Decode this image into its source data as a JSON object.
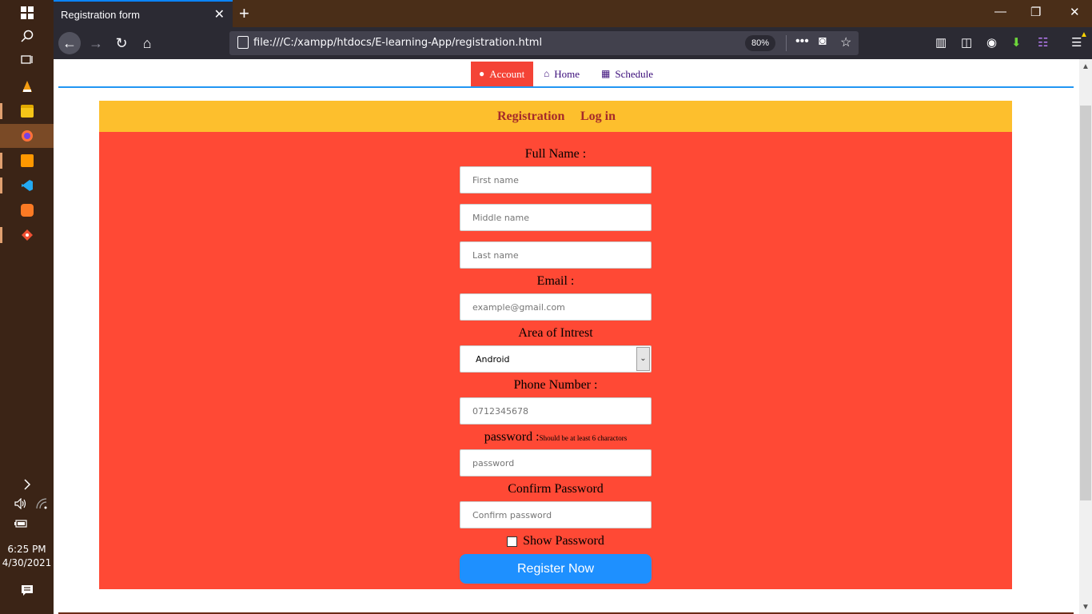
{
  "taskbar": {
    "clock_time": "6:25 PM",
    "clock_date": "4/30/2021"
  },
  "browser": {
    "tab_title": "Registration form",
    "url": "file:///C:/xampp/htdocs/E-learning-App/registration.html",
    "zoom": "80%",
    "accent_color": "#0a84ff"
  },
  "page": {
    "nav": [
      {
        "label": "Account",
        "icon": "user-icon"
      },
      {
        "label": "Home",
        "icon": "home-icon"
      },
      {
        "label": "Schedule",
        "icon": "calendar-icon"
      }
    ],
    "header_links": [
      "Registration",
      "Log in"
    ],
    "form": {
      "full_name_label": "Full Name :",
      "first_name_placeholder": "First name",
      "middle_name_placeholder": "Middle name",
      "last_name_placeholder": "Last name",
      "email_label": "Email :",
      "email_placeholder": "example@gmail.com",
      "interest_label": "Area of Intrest",
      "interest_selected": "Android",
      "phone_label": "Phone Number :",
      "phone_placeholder": "0712345678",
      "password_label": "password :",
      "password_hint": "Should be at least 6 charactors",
      "password_placeholder": "password",
      "confirm_label": "Confirm Password",
      "confirm_placeholder": "Confirm password",
      "show_password_label": "Show Password",
      "register_button": "Register Now"
    },
    "colors": {
      "form_bg": "#ff4935",
      "header_bg": "#fdbf2d",
      "button_bg": "#1e90ff",
      "nav_active": "#f44336"
    }
  }
}
